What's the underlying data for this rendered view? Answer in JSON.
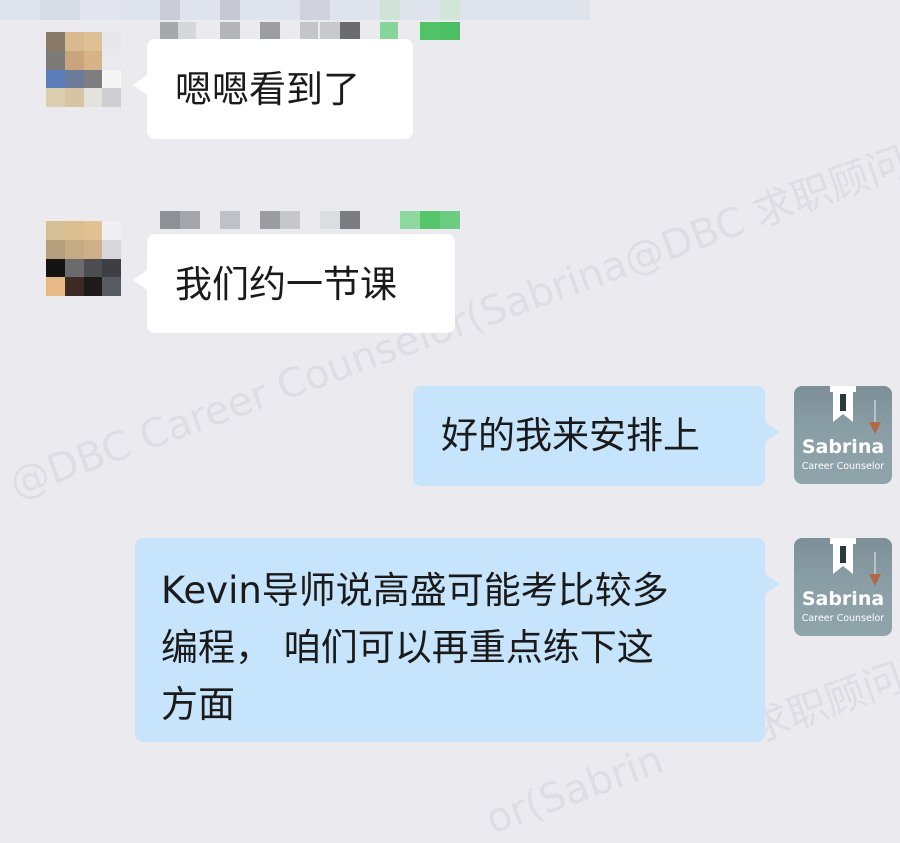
{
  "messages": [
    {
      "side": "left",
      "text": "嗯嗯看到了"
    },
    {
      "side": "left",
      "text": "我们约一节课"
    },
    {
      "side": "right",
      "text": "好的我来安排上"
    },
    {
      "side": "right",
      "lines": [
        "Kevin导师说高盛可能考比较多",
        "编程， 咱们可以再重点练下这",
        "方面"
      ]
    }
  ],
  "counselor": {
    "name": "Sabrina",
    "title": "Career Counselor"
  },
  "watermarks": [
    "@DBC Career Counselor(Sabrina@DBC 求职顾问)@DBC 职梦",
    "求职顾问)",
    "or(Sabrin"
  ],
  "colors": {
    "background": "#ebebef",
    "bubble_left": "#ffffff",
    "bubble_right": "#c6e4fb"
  }
}
